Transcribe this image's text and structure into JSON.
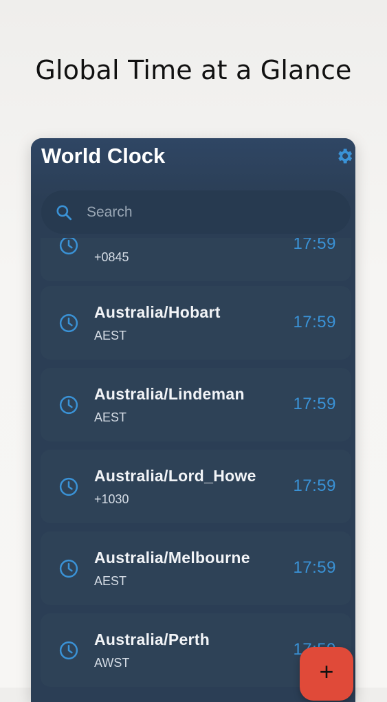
{
  "banner": {
    "tagline": "Global Time at a Glance"
  },
  "app": {
    "title": "World Clock"
  },
  "search": {
    "placeholder": "Search"
  },
  "clocks": [
    {
      "zone": "",
      "abbr": "+0845",
      "time": "17:59"
    },
    {
      "zone": "Australia/Hobart",
      "abbr": "AEST",
      "time": "17:59"
    },
    {
      "zone": "Australia/Lindeman",
      "abbr": "AEST",
      "time": "17:59"
    },
    {
      "zone": "Australia/Lord_Howe",
      "abbr": "+1030",
      "time": "17:59"
    },
    {
      "zone": "Australia/Melbourne",
      "abbr": "AEST",
      "time": "17:59"
    },
    {
      "zone": "Australia/Perth",
      "abbr": "AWST",
      "time": "17:59"
    }
  ],
  "fab": {
    "label": "+"
  },
  "colors": {
    "accent": "#3a92d6",
    "fab": "#e04a39",
    "background": "#2b3e55"
  }
}
